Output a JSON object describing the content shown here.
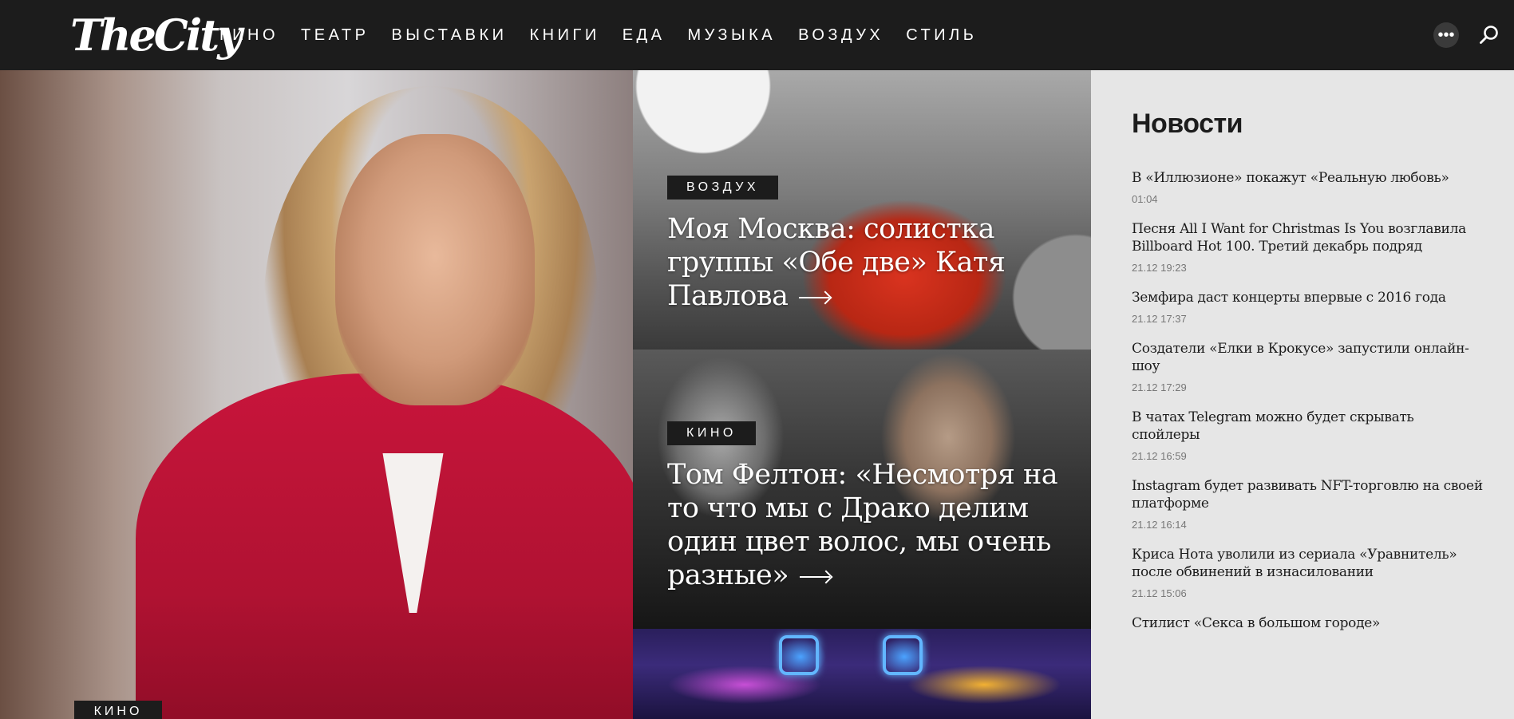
{
  "header": {
    "logo": "TheCity",
    "nav": [
      "КИНО",
      "ТЕАТР",
      "ВЫСТАВКИ",
      "КНИГИ",
      "ЕДА",
      "МУЗЫКА",
      "ВОЗДУХ",
      "СТИЛЬ"
    ],
    "more_icon": "more-dots-icon",
    "search_icon": "search-icon"
  },
  "hero": {
    "tag": "КИНО"
  },
  "cards": [
    {
      "tag": "ВОЗДУХ",
      "title": "Моя Москва: солистка группы «Обе две» Катя Павлова"
    },
    {
      "tag": "КИНО",
      "title": "Том Фелтон: «Несмотря на то что мы с Драко делим один цвет волос, мы очень разные»"
    }
  ],
  "news": {
    "title": "Новости",
    "items": [
      {
        "text": "В «Иллюзионе» покажут «Реальную любовь»",
        "time": "01:04"
      },
      {
        "text": "Песня All I Want for Christmas Is You возглавила Billboard Hot 100. Третий декабрь подряд",
        "time": "21.12 19:23"
      },
      {
        "text": "Земфира даст концерты впервые с 2016 года",
        "time": "21.12 17:37"
      },
      {
        "text": "Создатели «Елки в Крокусе» запустили онлайн-шоу",
        "time": "21.12 17:29"
      },
      {
        "text": "В чатах Telegram можно будет скрывать спойлеры",
        "time": "21.12 16:59"
      },
      {
        "text": "Instagram будет развивать NFT-торговлю на своей платформе",
        "time": "21.12 16:14"
      },
      {
        "text": "Криса Нота уволили из сериала «Уравнитель» после обвинений в изнасиловании",
        "time": "21.12 15:06"
      },
      {
        "text": "Стилист «Секса в большом городе»",
        "time": ""
      }
    ]
  }
}
